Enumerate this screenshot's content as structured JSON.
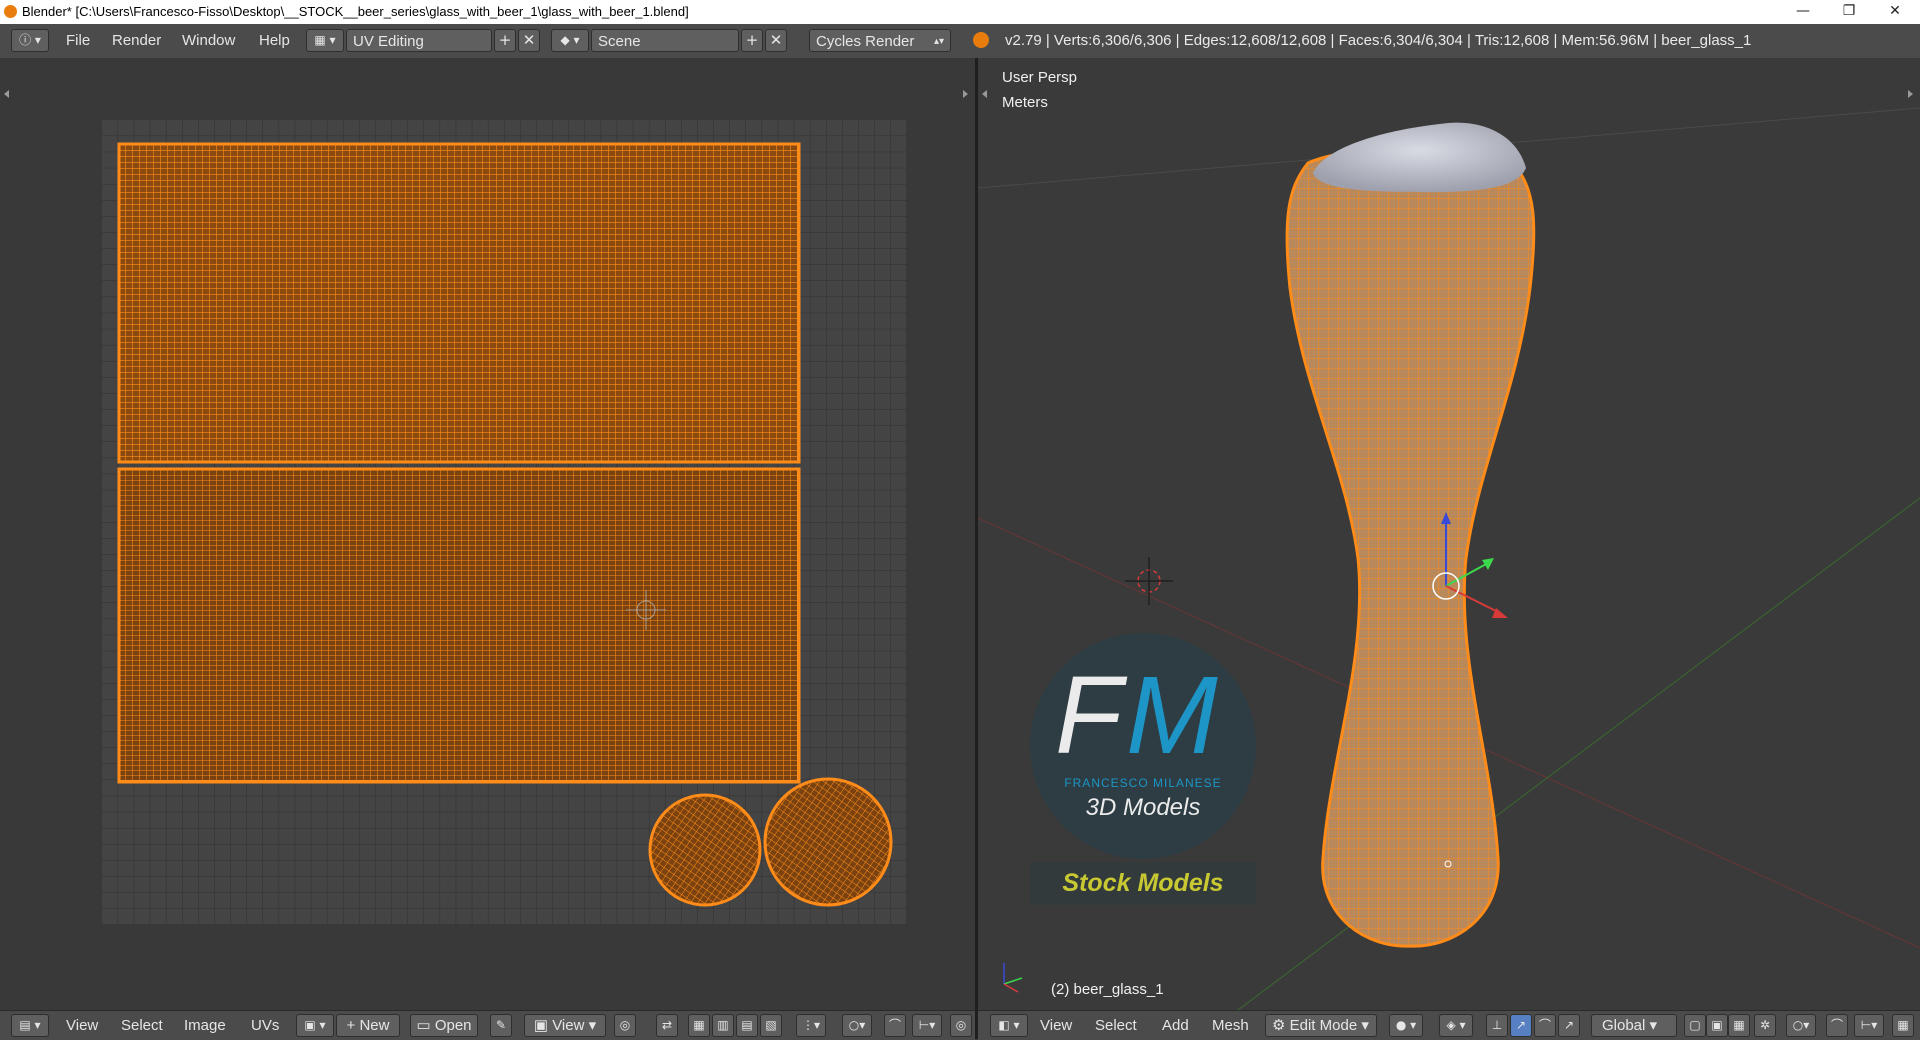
{
  "window": {
    "title": "Blender* [C:\\Users\\Francesco-Fisso\\Desktop\\__STOCK__beer_series\\glass_with_beer_1\\glass_with_beer_1.blend]",
    "minimize": "—",
    "restore": "❐",
    "close": "✕"
  },
  "info_header": {
    "menus": [
      "File",
      "Render",
      "Window",
      "Help"
    ],
    "screen_layout": "UV Editing",
    "scene": "Scene",
    "render_engine": "Cycles Render",
    "stats": "v2.79 | Verts:6,306/6,306 | Edges:12,608/12,608 | Faces:6,304/6,304 | Tris:12,608 | Mem:56.96M | beer_glass_1"
  },
  "uv_editor": {
    "footer": {
      "menus": [
        "View",
        "Select",
        "Image",
        "UVs"
      ],
      "new_label": "New",
      "open_label": "Open",
      "view_label": "View"
    }
  },
  "viewport": {
    "view_name": "User Persp",
    "units": "Meters",
    "object_label": "(2) beer_glass_1",
    "footer": {
      "menus": [
        "View",
        "Select",
        "Add",
        "Mesh"
      ],
      "mode": "Edit Mode",
      "orientation": "Global"
    }
  },
  "watermark": {
    "letters_f": "F",
    "letters_m": "M",
    "name": "FRANCESCO MILANESE",
    "tagline": "3D Models",
    "badge": "Stock Models"
  },
  "colors": {
    "selection_orange": "#ff8c19",
    "brand_blue": "#1a9fd6",
    "badge_yellow": "#c8c832"
  }
}
